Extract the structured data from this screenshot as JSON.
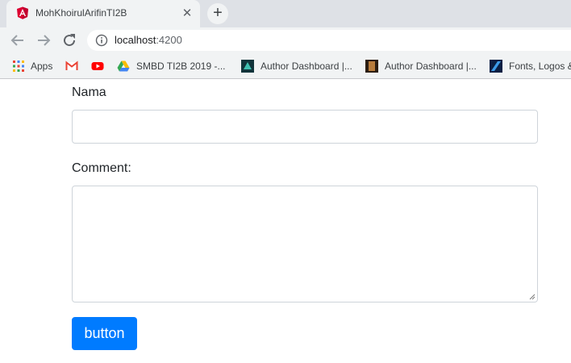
{
  "browser": {
    "tab": {
      "title": "MohKhoirulArifinTI2B",
      "close_glyph": "✕"
    },
    "new_tab_glyph": "+",
    "address": {
      "host": "localhost",
      "port": ":4200"
    },
    "bookmarks": [
      {
        "label": "Apps",
        "icon": "apps-grid-icon"
      },
      {
        "label": "",
        "icon": "gmail-icon"
      },
      {
        "label": "",
        "icon": "youtube-icon"
      },
      {
        "label": "SMBD TI2B 2019 -...",
        "icon": "google-drive-icon"
      },
      {
        "label": "Author Dashboard |...",
        "icon": "author-dashboard-icon"
      },
      {
        "label": "Author Dashboard |...",
        "icon": "author-dashboard-icon"
      },
      {
        "label": "Fonts, Logos &",
        "icon": "fonts-logos-icon"
      }
    ]
  },
  "form": {
    "name_label": "Nama",
    "name_value": "",
    "comment_label": "Comment:",
    "comment_value": "",
    "button_label": "button"
  },
  "colors": {
    "button": "#007bff",
    "tab_strip": "#dee1e6",
    "toolbar": "#f1f3f4",
    "angular_red": "#dd0031"
  }
}
